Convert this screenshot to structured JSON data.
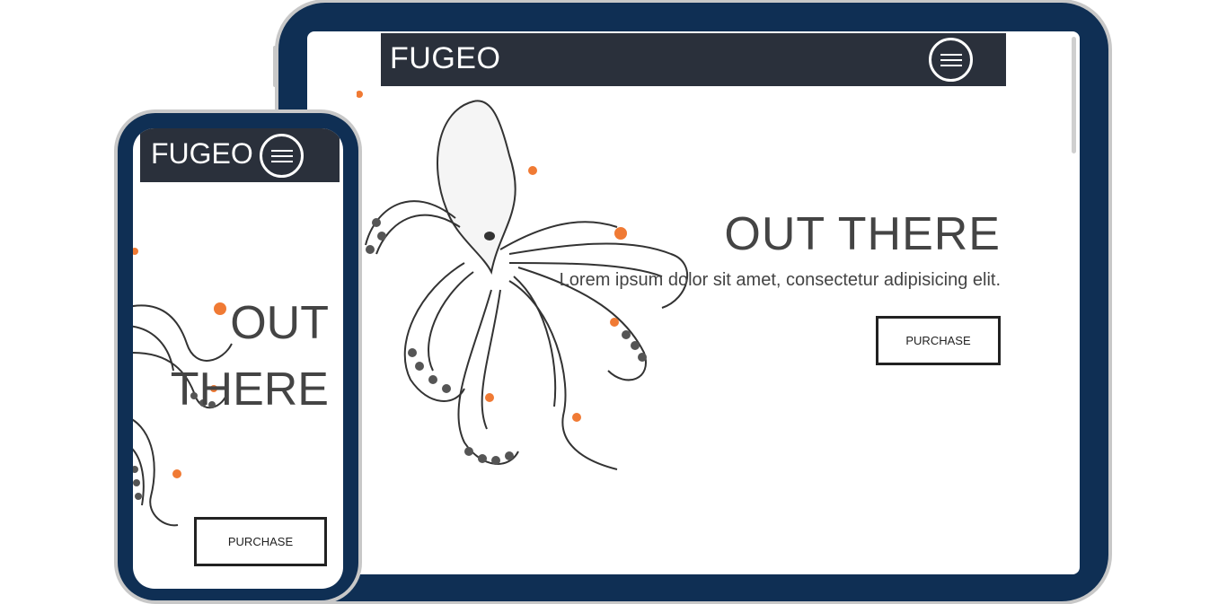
{
  "tablet": {
    "brand": "FUGEO",
    "menu_icon": "hamburger-menu-icon",
    "hero_title": "OUT THERE",
    "hero_text": "Lorem ipsum dolor sit amet, consectetur adipisicing elit.",
    "purchase_label": "PURCHASE"
  },
  "phone": {
    "brand": "FUGEO",
    "menu_icon": "hamburger-menu-icon",
    "hero_title": "OUT THERE",
    "purchase_label": "PURCHASE"
  },
  "colors": {
    "device_frame": "#0f2f54",
    "nav_bar": "#2a303b",
    "accent_dots": "#f07a34",
    "text": "#444444"
  }
}
